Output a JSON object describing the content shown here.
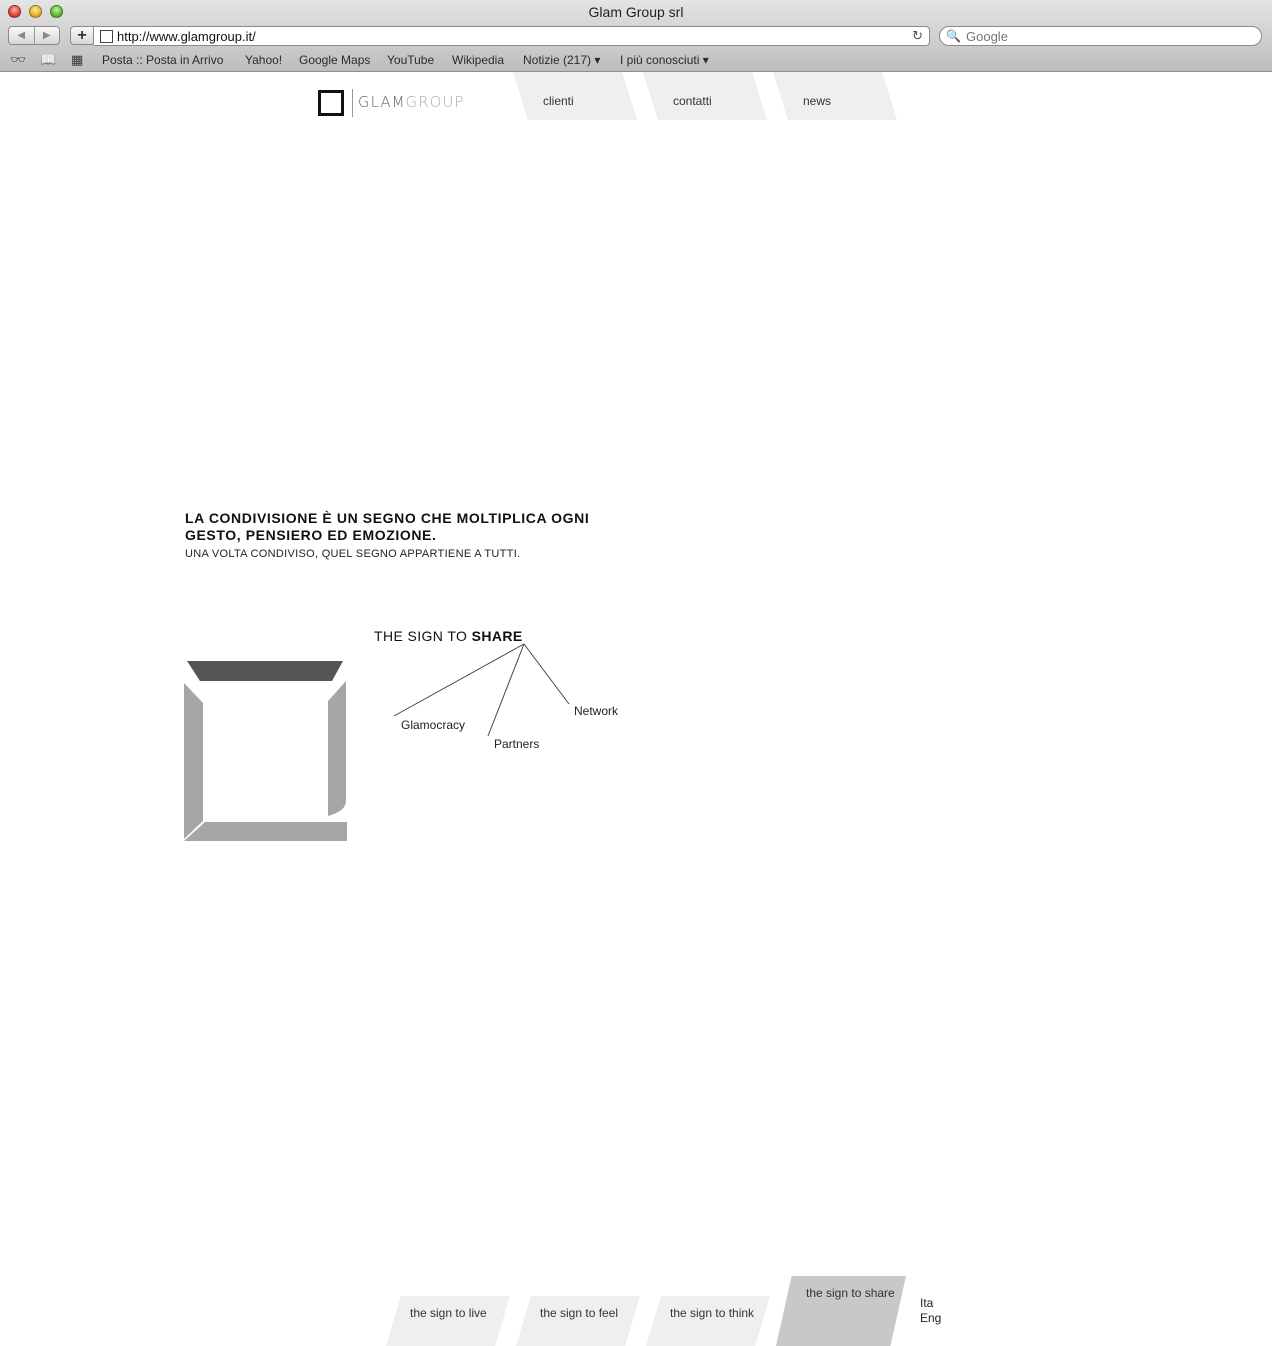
{
  "window": {
    "title": "Glam Group srl"
  },
  "toolbar": {
    "url": "http://www.glamgroup.it/",
    "search_placeholder": "Google"
  },
  "bookmarks": [
    "Posta :: Posta in Arrivo",
    "Yahoo!",
    "Google Maps",
    "YouTube",
    "Wikipedia",
    "Notizie (217) ▾",
    "I più conosciuti ▾"
  ],
  "site": {
    "logo": {
      "glam": "GLAM",
      "group": "GROUP"
    },
    "topnav": [
      "clienti",
      "contatti",
      "news"
    ],
    "headline": "LA CONDIVISIONE È UN SEGNO CHE MOLTIPLICA OGNI GESTO, PENSIERO ED EMOZIONE.",
    "subline": "UNA VOLTA CONDIVISO, QUEL SEGNO APPARTIENE A TUTTI.",
    "sign_title_prefix": "THE SIGN TO ",
    "sign_title_bold": "SHARE",
    "tree_items": [
      "Glamocracy",
      "Partners",
      "Network"
    ],
    "bottom_tabs": [
      {
        "label": "the sign to live",
        "active": false
      },
      {
        "label": "the sign to feel",
        "active": false
      },
      {
        "label": "the sign to think",
        "active": false
      },
      {
        "label": "the sign to share",
        "active": true
      }
    ],
    "languages": [
      "Ita",
      "Eng"
    ]
  },
  "colors": {
    "tab_bg": "#efefef",
    "tab_active_bg": "#c8c8c8",
    "mark_dark": "#555555",
    "mark_light": "#a6a6a6"
  }
}
